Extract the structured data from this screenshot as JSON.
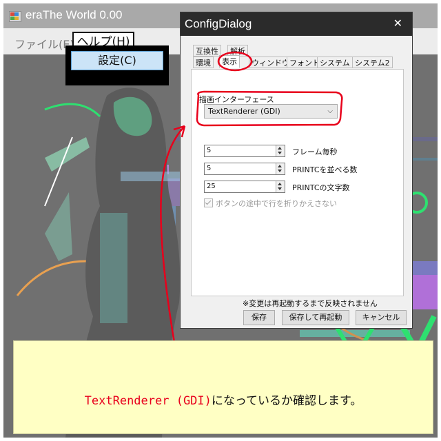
{
  "main_window": {
    "title": "eraThe World 0.00"
  },
  "menu": {
    "file": "ファイル(E)",
    "help": "ヘルプ(H)",
    "help_item_settings": "設定(C)"
  },
  "dialog": {
    "title": "ConfigDialog",
    "close_glyph": "✕",
    "tabs_row1": [
      "互換性",
      "解析"
    ],
    "tabs_row2": [
      "環境",
      "表示",
      "ウィンドウ",
      "フォント",
      "システム",
      "システム2"
    ],
    "active_tab": "表示",
    "renderer_label": "描画インターフェース",
    "renderer_value": "TextRenderer (GDI)",
    "fields": [
      {
        "value": "5",
        "label": "フレーム毎秒"
      },
      {
        "value": "5",
        "label": "PRINTCを並べる数"
      },
      {
        "value": "25",
        "label": "PRINTCの文字数"
      }
    ],
    "checkbox_label": "ボタンの途中で行を折りかえさない",
    "checkbox_checked": true,
    "checkbox_enabled": false,
    "note": "※変更は再起動するまで反映されません",
    "buttons": {
      "save": "保存",
      "save_restart": "保存して再起動",
      "cancel": "キャンセル"
    }
  },
  "caption": {
    "highlight": "TextRenderer (GDI)",
    "rest": "になっているか確認します。"
  },
  "colors": {
    "annotation_red": "#e8001c",
    "caption_bg": "#ffffc4",
    "dialog_title_bg": "#2b2b2b"
  },
  "icons": {
    "app": "app-window-icon",
    "close": "close-icon",
    "dropdown": "chevron-down-icon",
    "spin": "spin-updown-icon"
  }
}
